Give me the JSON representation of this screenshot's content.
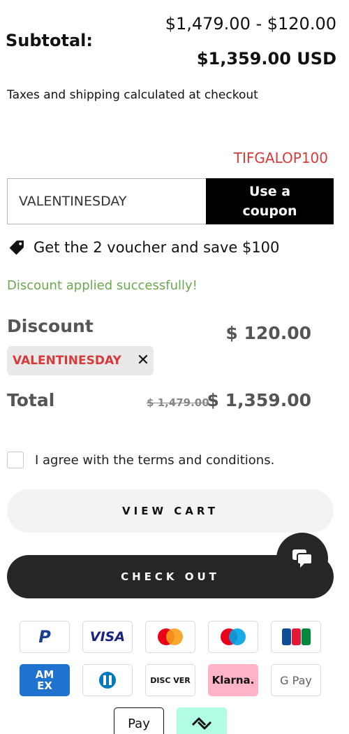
{
  "subtotal": {
    "label": "Subtotal:",
    "range": "$1,479.00 - $120.00",
    "total": "$1,359.00 USD",
    "tax_note": "Taxes and shipping calculated at checkout"
  },
  "coupon": {
    "code_hint": "TIFGALOP100",
    "input_value": "VALENTINESDAY",
    "button_line1": "Use a",
    "button_line2": "coupon"
  },
  "voucher": {
    "text": "Get the 2 voucher and save $100",
    "icon": "tag-icon"
  },
  "success_message": "Discount applied successfully!",
  "discount": {
    "label": "Discount",
    "amount": "$ 120.00",
    "chip_label": "VALENTINESDAY",
    "chip_close": "✕"
  },
  "total": {
    "label": "Total",
    "old": "$ 1,479.00",
    "new": "$ 1,359.00"
  },
  "terms": {
    "label": "I agree with the terms and conditions.",
    "checked": false
  },
  "buttons": {
    "view_cart": "VIEW CART",
    "checkout": "CHECK OUT"
  },
  "chat": {
    "icon": "chat-icon"
  },
  "payment_methods": {
    "paypal": "P",
    "visa": "VISA",
    "jcb": "JCB",
    "amex_line1": "AM",
    "amex_line2": "EX",
    "discover": "DISC VER",
    "klarna": "Klarna.",
    "gpay": "G Pay",
    "applepay": "Pay"
  },
  "colors": {
    "accent_red": "#d63b3b",
    "success_green": "#6aa84f",
    "dark": "#262626"
  }
}
